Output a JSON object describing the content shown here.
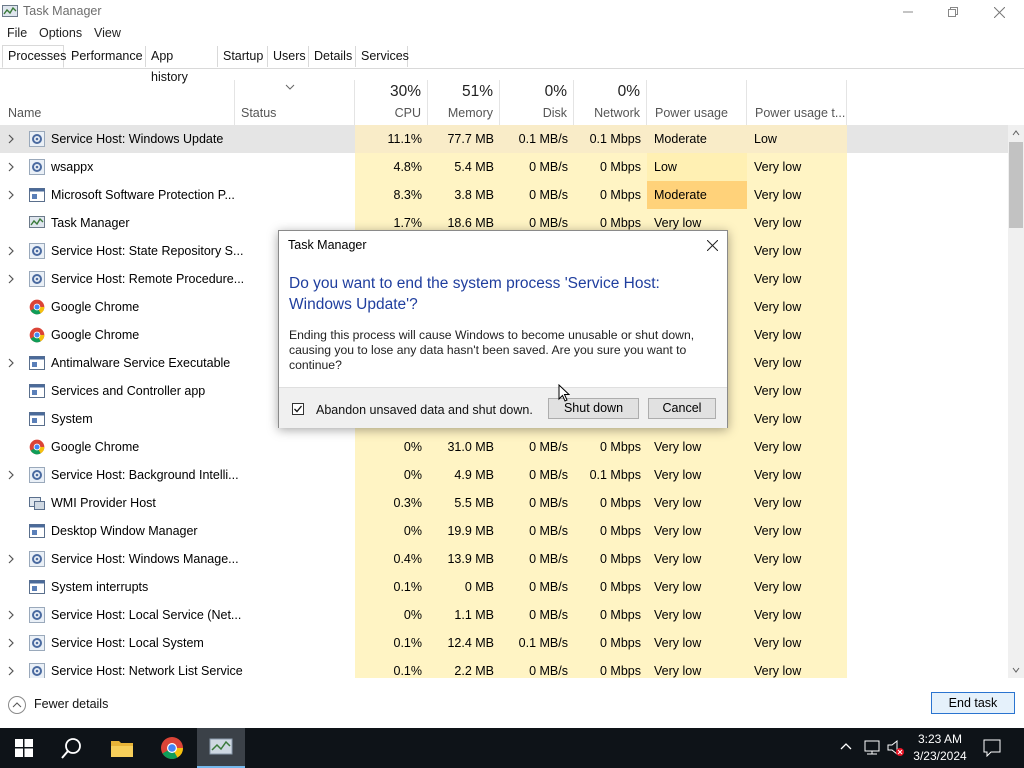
{
  "window": {
    "title": "Task Manager"
  },
  "menu": [
    "File",
    "Options",
    "View"
  ],
  "tabs": [
    "Processes",
    "Performance",
    "App history",
    "Startup",
    "Users",
    "Details",
    "Services"
  ],
  "columns": {
    "name": "Name",
    "status": "Status",
    "cpu": {
      "pct": "30%",
      "label": "CPU"
    },
    "memory": {
      "pct": "51%",
      "label": "Memory"
    },
    "disk": {
      "pct": "0%",
      "label": "Disk"
    },
    "network": {
      "pct": "0%",
      "label": "Network"
    },
    "power": "Power usage",
    "power_trend": "Power usage t..."
  },
  "processes": [
    {
      "name": "Service Host: Windows Update",
      "icon": "gear-icon",
      "expand": true,
      "cpu": "11.1%",
      "mem": "77.7 MB",
      "disk": "0.1 MB/s",
      "net": "0.1 Mbps",
      "power": "Moderate",
      "trend": "Low",
      "selected": true
    },
    {
      "name": "wsappx",
      "icon": "gear-icon",
      "expand": true,
      "cpu": "4.8%",
      "mem": "5.4 MB",
      "disk": "0 MB/s",
      "net": "0 Mbps",
      "power": "Low",
      "trend": "Very low"
    },
    {
      "name": "Microsoft Software Protection P...",
      "icon": "window-icon",
      "expand": true,
      "cpu": "8.3%",
      "mem": "3.8 MB",
      "disk": "0 MB/s",
      "net": "0 Mbps",
      "power": "Moderate",
      "trend": "Very low",
      "power_hot": true
    },
    {
      "name": "Task Manager",
      "icon": "taskmgr-icon",
      "expand": false,
      "cpu": "1.7%",
      "mem": "18.6 MB",
      "disk": "0 MB/s",
      "net": "0 Mbps",
      "power": "Very low",
      "trend": "Very low"
    },
    {
      "name": "Service Host: State Repository S...",
      "icon": "gear-icon",
      "expand": true,
      "cpu": "",
      "mem": "",
      "disk": "",
      "net": "",
      "power": "",
      "trend": "Very low"
    },
    {
      "name": "Service Host: Remote Procedure...",
      "icon": "gear-icon",
      "expand": true,
      "cpu": "",
      "mem": "",
      "disk": "",
      "net": "",
      "power": "",
      "trend": "Very low"
    },
    {
      "name": "Google Chrome",
      "icon": "chrome-icon",
      "expand": false,
      "cpu": "",
      "mem": "",
      "disk": "",
      "net": "",
      "power": "",
      "trend": "Very low"
    },
    {
      "name": "Google Chrome",
      "icon": "chrome-icon",
      "expand": false,
      "cpu": "",
      "mem": "",
      "disk": "",
      "net": "",
      "power": "",
      "trend": "Very low"
    },
    {
      "name": "Antimalware Service Executable",
      "icon": "window-icon",
      "expand": true,
      "cpu": "",
      "mem": "",
      "disk": "",
      "net": "",
      "power": "",
      "trend": "Very low"
    },
    {
      "name": "Services and Controller app",
      "icon": "window-icon",
      "expand": false,
      "cpu": "",
      "mem": "",
      "disk": "",
      "net": "",
      "power": "",
      "trend": "Very low"
    },
    {
      "name": "System",
      "icon": "window-icon",
      "expand": false,
      "cpu": "",
      "mem": "",
      "disk": "",
      "net": "",
      "power": "",
      "trend": "Very low"
    },
    {
      "name": "Google Chrome",
      "icon": "chrome-icon",
      "expand": false,
      "cpu": "0%",
      "mem": "31.0 MB",
      "disk": "0 MB/s",
      "net": "0 Mbps",
      "power": "Very low",
      "trend": "Very low"
    },
    {
      "name": "Service Host: Background Intelli...",
      "icon": "gear-icon",
      "expand": true,
      "cpu": "0%",
      "mem": "4.9 MB",
      "disk": "0 MB/s",
      "net": "0.1 Mbps",
      "power": "Very low",
      "trend": "Very low"
    },
    {
      "name": "WMI Provider Host",
      "icon": "wmi-icon",
      "expand": false,
      "cpu": "0.3%",
      "mem": "5.5 MB",
      "disk": "0 MB/s",
      "net": "0 Mbps",
      "power": "Very low",
      "trend": "Very low"
    },
    {
      "name": "Desktop Window Manager",
      "icon": "window-icon",
      "expand": false,
      "cpu": "0%",
      "mem": "19.9 MB",
      "disk": "0 MB/s",
      "net": "0 Mbps",
      "power": "Very low",
      "trend": "Very low"
    },
    {
      "name": "Service Host: Windows Manage...",
      "icon": "gear-icon",
      "expand": true,
      "cpu": "0.4%",
      "mem": "13.9 MB",
      "disk": "0 MB/s",
      "net": "0 Mbps",
      "power": "Very low",
      "trend": "Very low"
    },
    {
      "name": "System interrupts",
      "icon": "window-icon",
      "expand": false,
      "cpu": "0.1%",
      "mem": "0 MB",
      "disk": "0 MB/s",
      "net": "0 Mbps",
      "power": "Very low",
      "trend": "Very low"
    },
    {
      "name": "Service Host: Local Service (Net...",
      "icon": "gear-icon",
      "expand": true,
      "cpu": "0%",
      "mem": "1.1 MB",
      "disk": "0 MB/s",
      "net": "0 Mbps",
      "power": "Very low",
      "trend": "Very low"
    },
    {
      "name": "Service Host: Local System",
      "icon": "gear-icon",
      "expand": true,
      "cpu": "0.1%",
      "mem": "12.4 MB",
      "disk": "0.1 MB/s",
      "net": "0 Mbps",
      "power": "Very low",
      "trend": "Very low"
    },
    {
      "name": "Service Host: Network List Service",
      "icon": "gear-icon",
      "expand": true,
      "cpu": "0.1%",
      "mem": "2.2 MB",
      "disk": "0 MB/s",
      "net": "0 Mbps",
      "power": "Very low",
      "trend": "Very low"
    }
  ],
  "footer": {
    "fewer_details": "Fewer details",
    "end_task": "End task"
  },
  "dialog": {
    "title": "Task Manager",
    "heading": "Do you want to end the system process 'Service Host: Windows Update'?",
    "body": "Ending this process will cause Windows to become unusable or shut down, causing you to lose any data hasn't been saved. Are you sure you want to continue?",
    "checkbox_label": "Abandon unsaved data and shut down.",
    "checkbox_checked": true,
    "shutdown_label": "Shut down",
    "cancel_label": "Cancel"
  },
  "taskbar": {
    "apps": [
      "start-icon",
      "search-icon",
      "file-explorer-icon",
      "chrome-icon",
      "task-manager-icon"
    ],
    "time": "3:23 AM",
    "date": "3/23/2024"
  },
  "colors": {
    "heat_light": "#fff4c4",
    "heat_low": "#fff0b3",
    "heat_mod": "#f9ecc8",
    "heat_hot": "#ffd27a",
    "dialog_heading": "#1f3e9e",
    "taskbar": "#0e1318",
    "accent": "#2a74d0"
  }
}
